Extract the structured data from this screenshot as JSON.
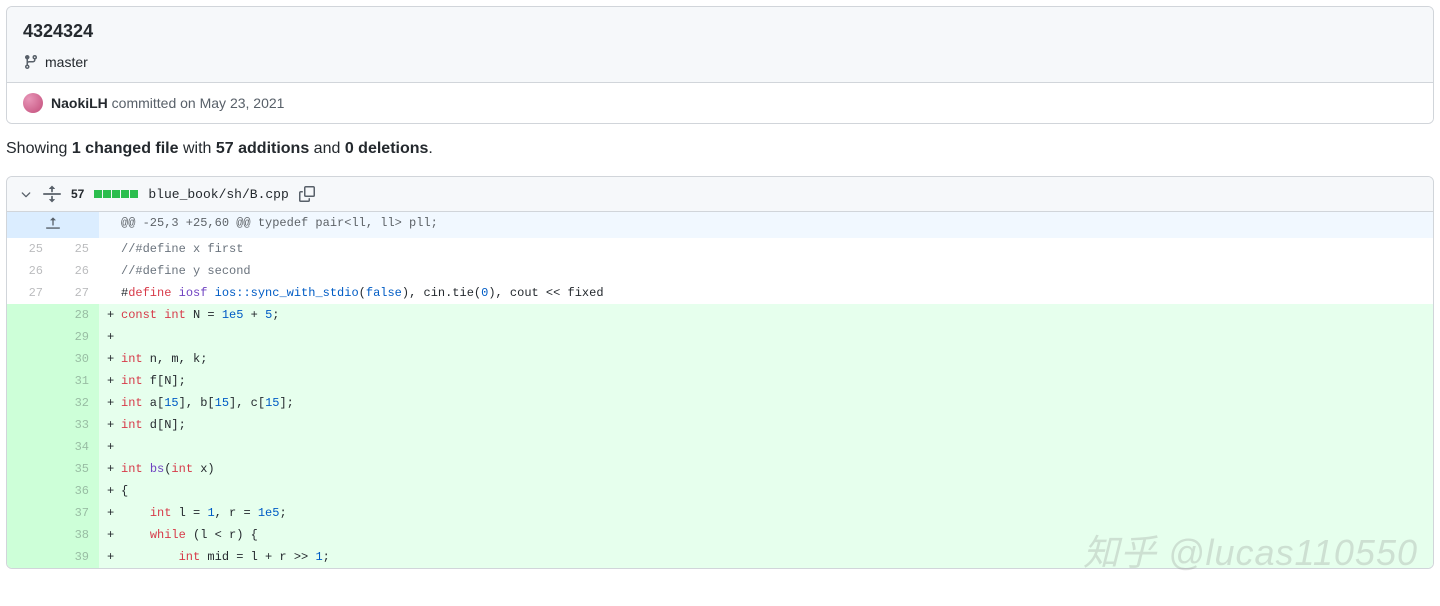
{
  "commit": {
    "title": "4324324",
    "branch": "master",
    "author": "NaokiLH",
    "meta": " committed on May 23, 2021"
  },
  "summary": {
    "pre": "Showing ",
    "changed": "1 changed file",
    "mid1": " with ",
    "adds": "57 additions",
    "mid2": " and ",
    "dels": "0 deletions",
    "post": "."
  },
  "file": {
    "lines": "57",
    "path": "blue_book/sh/B.cpp"
  },
  "hunk_header": "@@ -25,3 +25,60 @@ typedef pair<ll, ll> pll;",
  "lines": [
    {
      "old": "25",
      "new": "25",
      "add": false,
      "marker": " ",
      "code": [
        {
          "c": "tok-c",
          "t": "//#define x first"
        }
      ]
    },
    {
      "old": "26",
      "new": "26",
      "add": false,
      "marker": " ",
      "code": [
        {
          "c": "tok-c",
          "t": "//#define y second"
        }
      ]
    },
    {
      "old": "27",
      "new": "27",
      "add": false,
      "marker": " ",
      "code": [
        {
          "t": "#"
        },
        {
          "c": "tok-k",
          "t": "define"
        },
        {
          "t": " "
        },
        {
          "c": "tok-f",
          "t": "iosf"
        },
        {
          "t": " "
        },
        {
          "c": "tok-n",
          "t": "ios::sync_with_stdio"
        },
        {
          "t": "("
        },
        {
          "c": "tok-n",
          "t": "false"
        },
        {
          "t": "), cin.tie("
        },
        {
          "c": "tok-n",
          "t": "0"
        },
        {
          "t": "), cout << fixed"
        }
      ]
    },
    {
      "old": "",
      "new": "28",
      "add": true,
      "marker": "+",
      "code": [
        {
          "c": "tok-k",
          "t": "const"
        },
        {
          "t": " "
        },
        {
          "c": "tok-k",
          "t": "int"
        },
        {
          "t": " N = "
        },
        {
          "c": "tok-n",
          "t": "1e5"
        },
        {
          "t": " + "
        },
        {
          "c": "tok-n",
          "t": "5"
        },
        {
          "t": ";"
        }
      ]
    },
    {
      "old": "",
      "new": "29",
      "add": true,
      "marker": "+",
      "code": []
    },
    {
      "old": "",
      "new": "30",
      "add": true,
      "marker": "+",
      "code": [
        {
          "c": "tok-k",
          "t": "int"
        },
        {
          "t": " n, m, k;"
        }
      ]
    },
    {
      "old": "",
      "new": "31",
      "add": true,
      "marker": "+",
      "code": [
        {
          "c": "tok-k",
          "t": "int"
        },
        {
          "t": " f[N];"
        }
      ]
    },
    {
      "old": "",
      "new": "32",
      "add": true,
      "marker": "+",
      "code": [
        {
          "c": "tok-k",
          "t": "int"
        },
        {
          "t": " a["
        },
        {
          "c": "tok-n",
          "t": "15"
        },
        {
          "t": "], b["
        },
        {
          "c": "tok-n",
          "t": "15"
        },
        {
          "t": "], c["
        },
        {
          "c": "tok-n",
          "t": "15"
        },
        {
          "t": "];"
        }
      ]
    },
    {
      "old": "",
      "new": "33",
      "add": true,
      "marker": "+",
      "code": [
        {
          "c": "tok-k",
          "t": "int"
        },
        {
          "t": " d[N];"
        }
      ]
    },
    {
      "old": "",
      "new": "34",
      "add": true,
      "marker": "+",
      "code": []
    },
    {
      "old": "",
      "new": "35",
      "add": true,
      "marker": "+",
      "code": [
        {
          "c": "tok-k",
          "t": "int"
        },
        {
          "t": " "
        },
        {
          "c": "tok-f",
          "t": "bs"
        },
        {
          "t": "("
        },
        {
          "c": "tok-k",
          "t": "int"
        },
        {
          "t": " x)"
        }
      ]
    },
    {
      "old": "",
      "new": "36",
      "add": true,
      "marker": "+",
      "code": [
        {
          "t": "{"
        }
      ]
    },
    {
      "old": "",
      "new": "37",
      "add": true,
      "marker": "+",
      "code": [
        {
          "t": "    "
        },
        {
          "c": "tok-k",
          "t": "int"
        },
        {
          "t": " l = "
        },
        {
          "c": "tok-n",
          "t": "1"
        },
        {
          "t": ", r = "
        },
        {
          "c": "tok-n",
          "t": "1e5"
        },
        {
          "t": ";"
        }
      ]
    },
    {
      "old": "",
      "new": "38",
      "add": true,
      "marker": "+",
      "code": [
        {
          "t": "    "
        },
        {
          "c": "tok-k",
          "t": "while"
        },
        {
          "t": " (l < r) {"
        }
      ]
    },
    {
      "old": "",
      "new": "39",
      "add": true,
      "marker": "+",
      "code": [
        {
          "t": "        "
        },
        {
          "c": "tok-k",
          "t": "int"
        },
        {
          "t": " mid = l + r >> "
        },
        {
          "c": "tok-n",
          "t": "1"
        },
        {
          "t": ";"
        }
      ]
    }
  ],
  "watermark": "知乎 @lucas110550"
}
